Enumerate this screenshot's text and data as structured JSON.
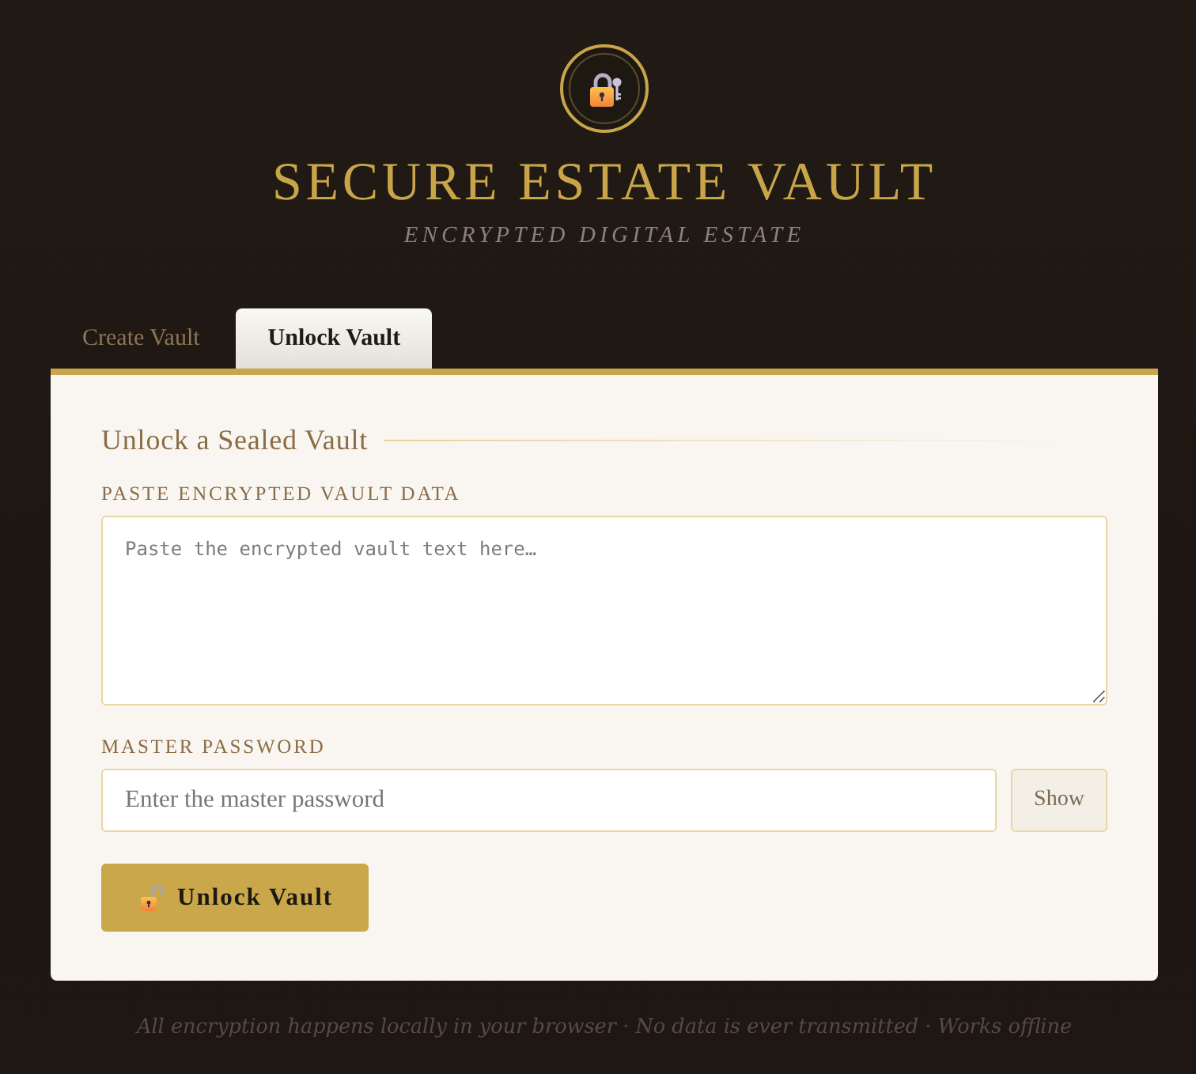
{
  "header": {
    "title": "SECURE ESTATE VAULT",
    "subtitle": "ENCRYPTED DIGITAL ESTATE"
  },
  "tabs": [
    {
      "label": "Create Vault",
      "selected": false
    },
    {
      "label": "Unlock Vault",
      "selected": true
    }
  ],
  "panel": {
    "heading": "Unlock a Sealed Vault",
    "fields": [
      {
        "kind": "textarea",
        "label": "PASTE ENCRYPTED VAULT DATA",
        "placeholder": "Paste the encrypted vault text here…"
      },
      {
        "kind": "password",
        "label": "MASTER PASSWORD",
        "placeholder": "Enter the master password",
        "toggle": "Show"
      }
    ],
    "submit": "Unlock Vault"
  },
  "footer": "All encryption happens locally in your browser · No data is ever transmitted · Works offline"
}
